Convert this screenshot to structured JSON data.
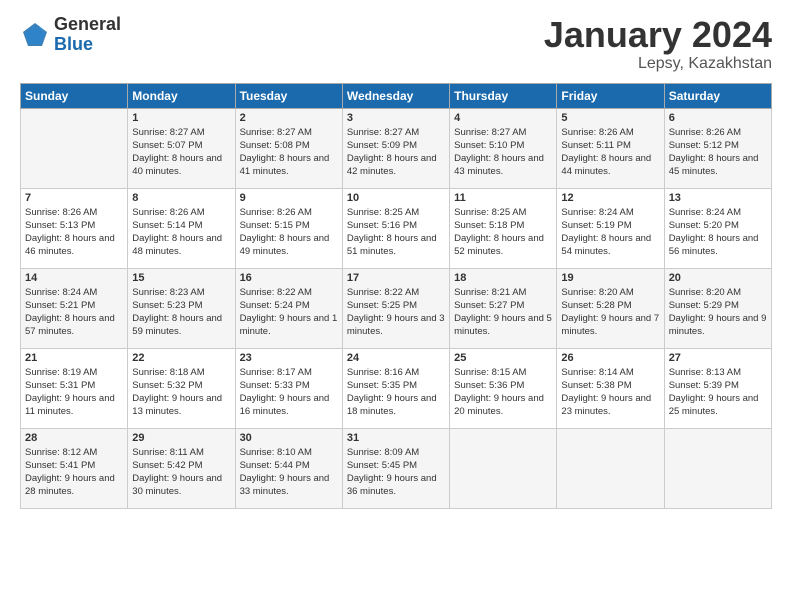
{
  "logo": {
    "general": "General",
    "blue": "Blue"
  },
  "title": "January 2024",
  "location": "Lepsy, Kazakhstan",
  "days_header": [
    "Sunday",
    "Monday",
    "Tuesday",
    "Wednesday",
    "Thursday",
    "Friday",
    "Saturday"
  ],
  "weeks": [
    [
      {
        "day": "",
        "sunrise": "",
        "sunset": "",
        "daylight": ""
      },
      {
        "day": "1",
        "sunrise": "Sunrise: 8:27 AM",
        "sunset": "Sunset: 5:07 PM",
        "daylight": "Daylight: 8 hours and 40 minutes."
      },
      {
        "day": "2",
        "sunrise": "Sunrise: 8:27 AM",
        "sunset": "Sunset: 5:08 PM",
        "daylight": "Daylight: 8 hours and 41 minutes."
      },
      {
        "day": "3",
        "sunrise": "Sunrise: 8:27 AM",
        "sunset": "Sunset: 5:09 PM",
        "daylight": "Daylight: 8 hours and 42 minutes."
      },
      {
        "day": "4",
        "sunrise": "Sunrise: 8:27 AM",
        "sunset": "Sunset: 5:10 PM",
        "daylight": "Daylight: 8 hours and 43 minutes."
      },
      {
        "day": "5",
        "sunrise": "Sunrise: 8:26 AM",
        "sunset": "Sunset: 5:11 PM",
        "daylight": "Daylight: 8 hours and 44 minutes."
      },
      {
        "day": "6",
        "sunrise": "Sunrise: 8:26 AM",
        "sunset": "Sunset: 5:12 PM",
        "daylight": "Daylight: 8 hours and 45 minutes."
      }
    ],
    [
      {
        "day": "7",
        "sunrise": "Sunrise: 8:26 AM",
        "sunset": "Sunset: 5:13 PM",
        "daylight": "Daylight: 8 hours and 46 minutes."
      },
      {
        "day": "8",
        "sunrise": "Sunrise: 8:26 AM",
        "sunset": "Sunset: 5:14 PM",
        "daylight": "Daylight: 8 hours and 48 minutes."
      },
      {
        "day": "9",
        "sunrise": "Sunrise: 8:26 AM",
        "sunset": "Sunset: 5:15 PM",
        "daylight": "Daylight: 8 hours and 49 minutes."
      },
      {
        "day": "10",
        "sunrise": "Sunrise: 8:25 AM",
        "sunset": "Sunset: 5:16 PM",
        "daylight": "Daylight: 8 hours and 51 minutes."
      },
      {
        "day": "11",
        "sunrise": "Sunrise: 8:25 AM",
        "sunset": "Sunset: 5:18 PM",
        "daylight": "Daylight: 8 hours and 52 minutes."
      },
      {
        "day": "12",
        "sunrise": "Sunrise: 8:24 AM",
        "sunset": "Sunset: 5:19 PM",
        "daylight": "Daylight: 8 hours and 54 minutes."
      },
      {
        "day": "13",
        "sunrise": "Sunrise: 8:24 AM",
        "sunset": "Sunset: 5:20 PM",
        "daylight": "Daylight: 8 hours and 56 minutes."
      }
    ],
    [
      {
        "day": "14",
        "sunrise": "Sunrise: 8:24 AM",
        "sunset": "Sunset: 5:21 PM",
        "daylight": "Daylight: 8 hours and 57 minutes."
      },
      {
        "day": "15",
        "sunrise": "Sunrise: 8:23 AM",
        "sunset": "Sunset: 5:23 PM",
        "daylight": "Daylight: 8 hours and 59 minutes."
      },
      {
        "day": "16",
        "sunrise": "Sunrise: 8:22 AM",
        "sunset": "Sunset: 5:24 PM",
        "daylight": "Daylight: 9 hours and 1 minute."
      },
      {
        "day": "17",
        "sunrise": "Sunrise: 8:22 AM",
        "sunset": "Sunset: 5:25 PM",
        "daylight": "Daylight: 9 hours and 3 minutes."
      },
      {
        "day": "18",
        "sunrise": "Sunrise: 8:21 AM",
        "sunset": "Sunset: 5:27 PM",
        "daylight": "Daylight: 9 hours and 5 minutes."
      },
      {
        "day": "19",
        "sunrise": "Sunrise: 8:20 AM",
        "sunset": "Sunset: 5:28 PM",
        "daylight": "Daylight: 9 hours and 7 minutes."
      },
      {
        "day": "20",
        "sunrise": "Sunrise: 8:20 AM",
        "sunset": "Sunset: 5:29 PM",
        "daylight": "Daylight: 9 hours and 9 minutes."
      }
    ],
    [
      {
        "day": "21",
        "sunrise": "Sunrise: 8:19 AM",
        "sunset": "Sunset: 5:31 PM",
        "daylight": "Daylight: 9 hours and 11 minutes."
      },
      {
        "day": "22",
        "sunrise": "Sunrise: 8:18 AM",
        "sunset": "Sunset: 5:32 PM",
        "daylight": "Daylight: 9 hours and 13 minutes."
      },
      {
        "day": "23",
        "sunrise": "Sunrise: 8:17 AM",
        "sunset": "Sunset: 5:33 PM",
        "daylight": "Daylight: 9 hours and 16 minutes."
      },
      {
        "day": "24",
        "sunrise": "Sunrise: 8:16 AM",
        "sunset": "Sunset: 5:35 PM",
        "daylight": "Daylight: 9 hours and 18 minutes."
      },
      {
        "day": "25",
        "sunrise": "Sunrise: 8:15 AM",
        "sunset": "Sunset: 5:36 PM",
        "daylight": "Daylight: 9 hours and 20 minutes."
      },
      {
        "day": "26",
        "sunrise": "Sunrise: 8:14 AM",
        "sunset": "Sunset: 5:38 PM",
        "daylight": "Daylight: 9 hours and 23 minutes."
      },
      {
        "day": "27",
        "sunrise": "Sunrise: 8:13 AM",
        "sunset": "Sunset: 5:39 PM",
        "daylight": "Daylight: 9 hours and 25 minutes."
      }
    ],
    [
      {
        "day": "28",
        "sunrise": "Sunrise: 8:12 AM",
        "sunset": "Sunset: 5:41 PM",
        "daylight": "Daylight: 9 hours and 28 minutes."
      },
      {
        "day": "29",
        "sunrise": "Sunrise: 8:11 AM",
        "sunset": "Sunset: 5:42 PM",
        "daylight": "Daylight: 9 hours and 30 minutes."
      },
      {
        "day": "30",
        "sunrise": "Sunrise: 8:10 AM",
        "sunset": "Sunset: 5:44 PM",
        "daylight": "Daylight: 9 hours and 33 minutes."
      },
      {
        "day": "31",
        "sunrise": "Sunrise: 8:09 AM",
        "sunset": "Sunset: 5:45 PM",
        "daylight": "Daylight: 9 hours and 36 minutes."
      },
      {
        "day": "",
        "sunrise": "",
        "sunset": "",
        "daylight": ""
      },
      {
        "day": "",
        "sunrise": "",
        "sunset": "",
        "daylight": ""
      },
      {
        "day": "",
        "sunrise": "",
        "sunset": "",
        "daylight": ""
      }
    ]
  ]
}
